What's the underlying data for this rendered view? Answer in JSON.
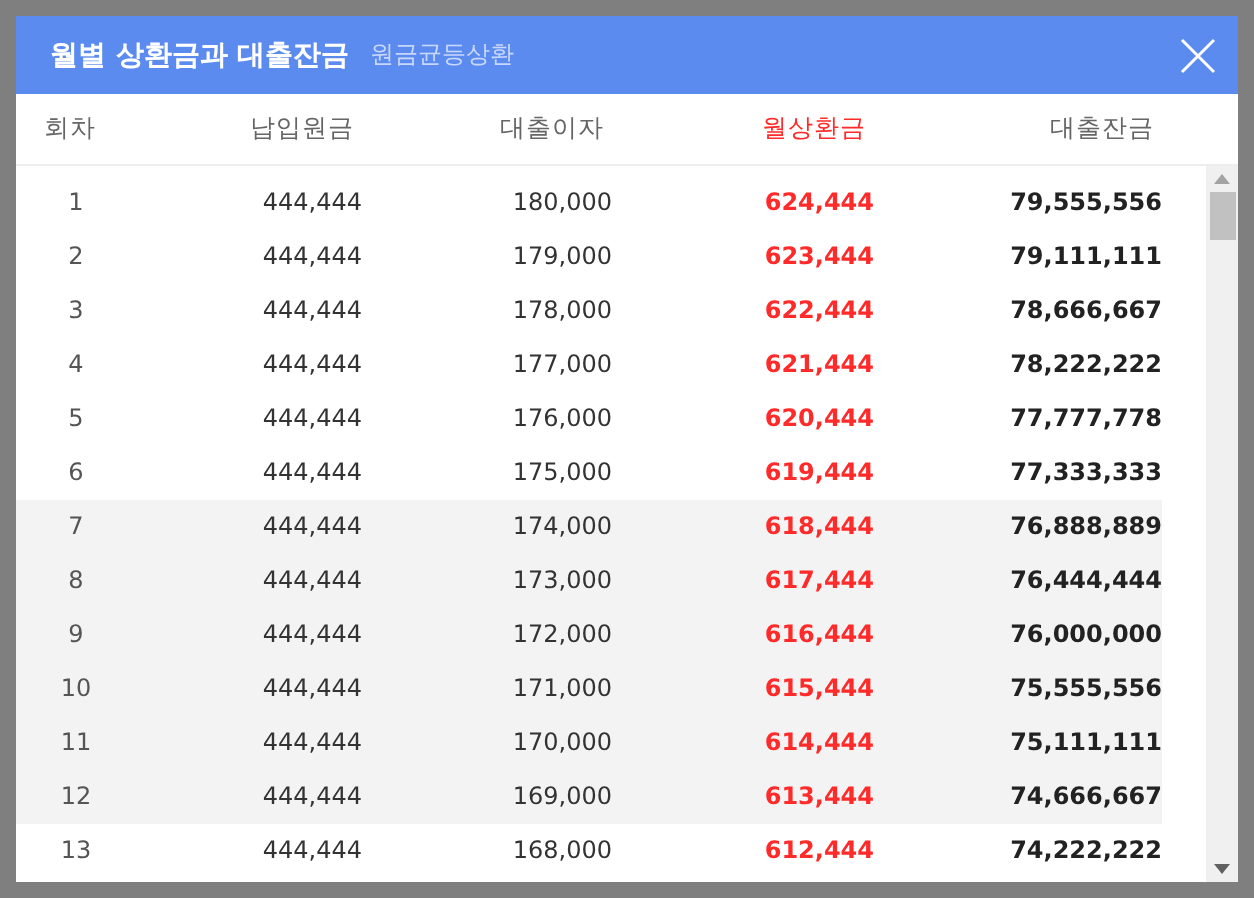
{
  "dialog": {
    "title": "월별 상환금과 대출잔금",
    "subtitle": "원금균등상환"
  },
  "table": {
    "columns": [
      {
        "label": "회차",
        "highlight": false
      },
      {
        "label": "납입원금",
        "highlight": false
      },
      {
        "label": "대출이자",
        "highlight": false
      },
      {
        "label": "월상환금",
        "highlight": true
      },
      {
        "label": "대출잔금",
        "highlight": false
      }
    ],
    "rows": [
      {
        "cells": [
          "1",
          "444,444",
          "180,000",
          "624,444",
          "79,555,556"
        ],
        "shaded": false
      },
      {
        "cells": [
          "2",
          "444,444",
          "179,000",
          "623,444",
          "79,111,111"
        ],
        "shaded": false
      },
      {
        "cells": [
          "3",
          "444,444",
          "178,000",
          "622,444",
          "78,666,667"
        ],
        "shaded": false
      },
      {
        "cells": [
          "4",
          "444,444",
          "177,000",
          "621,444",
          "78,222,222"
        ],
        "shaded": false
      },
      {
        "cells": [
          "5",
          "444,444",
          "176,000",
          "620,444",
          "77,777,778"
        ],
        "shaded": false
      },
      {
        "cells": [
          "6",
          "444,444",
          "175,000",
          "619,444",
          "77,333,333"
        ],
        "shaded": false
      },
      {
        "cells": [
          "7",
          "444,444",
          "174,000",
          "618,444",
          "76,888,889"
        ],
        "shaded": true
      },
      {
        "cells": [
          "8",
          "444,444",
          "173,000",
          "617,444",
          "76,444,444"
        ],
        "shaded": true
      },
      {
        "cells": [
          "9",
          "444,444",
          "172,000",
          "616,444",
          "76,000,000"
        ],
        "shaded": true
      },
      {
        "cells": [
          "10",
          "444,444",
          "171,000",
          "615,444",
          "75,555,556"
        ],
        "shaded": true
      },
      {
        "cells": [
          "11",
          "444,444",
          "170,000",
          "614,444",
          "75,111,111"
        ],
        "shaded": true
      },
      {
        "cells": [
          "12",
          "444,444",
          "169,000",
          "613,444",
          "74,666,667"
        ],
        "shaded": true
      },
      {
        "cells": [
          "13",
          "444,444",
          "168,000",
          "612,444",
          "74,222,222"
        ],
        "shaded": false
      }
    ]
  }
}
